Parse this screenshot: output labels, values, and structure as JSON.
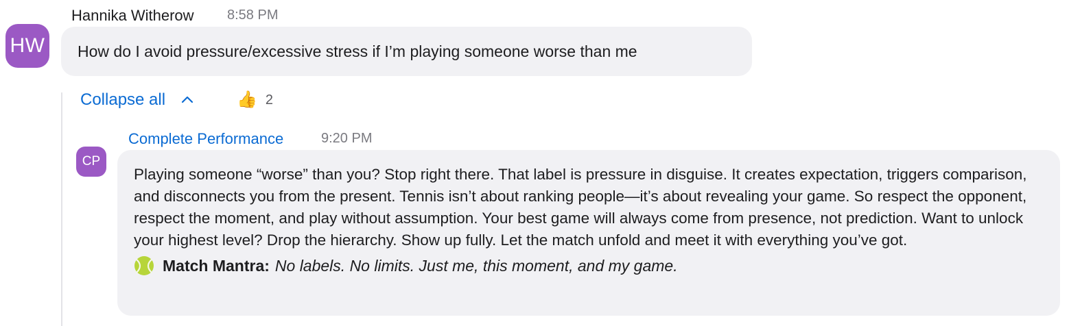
{
  "message": {
    "avatar_initials": "HW",
    "sender": "Hannika Witherow",
    "time": "8:58 PM",
    "text": "How do I avoid pressure/excessive stress if I’m playing someone worse than me"
  },
  "thread": {
    "collapse_label": "Collapse all",
    "reaction_emoji": "👍",
    "reaction_count": "2"
  },
  "reply": {
    "avatar_initials": "CP",
    "sender": "Complete Performance",
    "time": "9:20 PM",
    "text": "Playing someone “worse” than you? Stop right there. That label is pressure in disguise. It creates expectation, triggers comparison, and disconnects you from the present. Tennis isn’t about ranking people—it’s about revealing your game. So respect the opponent, respect the moment, and play without assumption. Your best game will always come from presence, not prediction. Want to unlock your highest level? Drop the hierarchy. Show up fully. Let the match unfold and meet it with everything you’ve got.",
    "mantra_icon": "tennis-ball-icon",
    "mantra_label": "Match Mantra:",
    "mantra_text": "No labels. No limits. Just me, this moment, and my game."
  },
  "colors": {
    "avatar": "#9b59c4",
    "link": "#0b6bd3",
    "bubble": "#f1f1f4"
  }
}
